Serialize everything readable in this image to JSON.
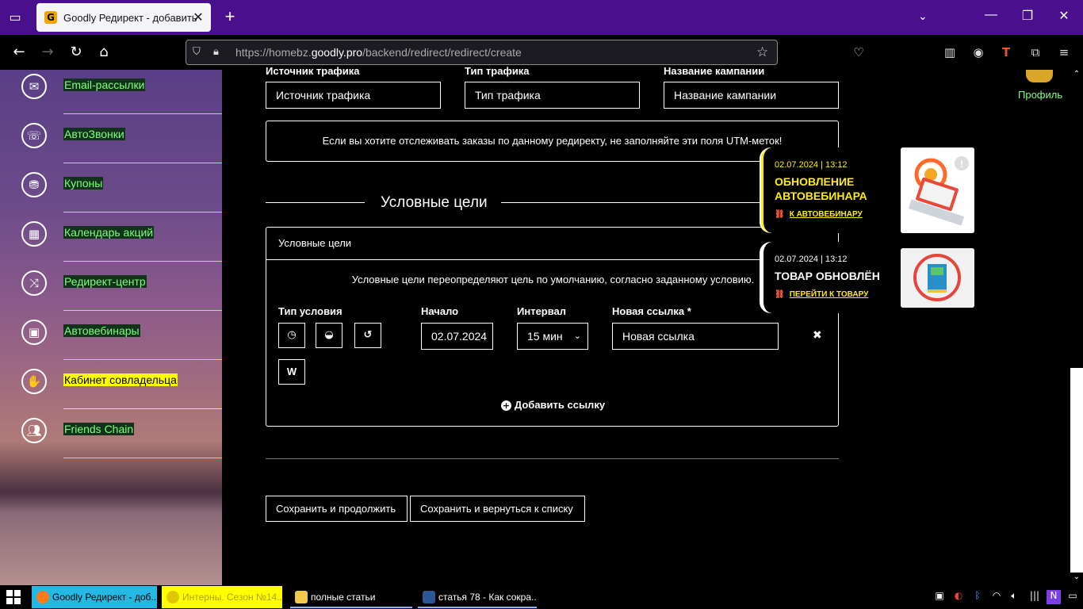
{
  "browser": {
    "tab_title": "Goodly Редирект - добавить",
    "url_prefix": "https://homebz.",
    "url_domain": "goodly.pro",
    "url_path": "/backend/redirect/redirect/create"
  },
  "sidebar": {
    "items": [
      {
        "label": "Email-рассылки",
        "icon": "envelope-icon"
      },
      {
        "label": "АвтоЗвонки",
        "icon": "phone-icon"
      },
      {
        "label": "Купоны",
        "icon": "coupon-icon"
      },
      {
        "label": "Календарь акций",
        "icon": "calendar-icon"
      },
      {
        "label": "Редирект-центр",
        "icon": "shuffle-icon"
      },
      {
        "label": "Автовебинары",
        "icon": "webinar-icon"
      },
      {
        "label": "Кабинет совладельца",
        "icon": "handshake-icon"
      },
      {
        "label": "Friends Chain",
        "icon": "friends-icon"
      }
    ]
  },
  "form": {
    "utm_source_label": "Источник трафика",
    "utm_source_placeholder": "Источник трафика",
    "utm_medium_label": "Тип трафика",
    "utm_medium_placeholder": "Тип трафика",
    "utm_campaign_label": "Название кампании",
    "utm_campaign_placeholder": "Название кампании",
    "utm_note": "Если вы хотите отслеживать заказы по данному редиректу, не заполняйте эти поля UTM-меток!",
    "section_title": "Условные цели",
    "panel_title": "Условные цели",
    "panel_description": "Условные цели переопределяют цель по умолчанию, согласно заданному условию.",
    "condition_type_label": "Тип условия",
    "start_label": "Начало",
    "start_value": "02.07.2024",
    "interval_label": "Интервал",
    "interval_value": "15 мин",
    "new_link_label": "Новая ссылка *",
    "new_link_placeholder": "Новая ссылка",
    "weekday_button": "W",
    "add_link": "Добавить ссылку",
    "save_continue": "Сохранить и продолжить",
    "save_return": "Сохранить и вернуться к списку"
  },
  "profile_label": "Профиль",
  "notifications": [
    {
      "date": "02.07.2024 | 13:12",
      "title_line1": "ОБНОВЛЕНИЕ",
      "title_line2": "АВТОВЕБИНАРА",
      "link": "К АВТОВЕБИНАРУ",
      "accent": "#ffee00"
    },
    {
      "date": "02.07.2024 | 13:12",
      "title_line1": "ТОВАР ОБНОВЛЁН",
      "title_line2": "",
      "link": "ПЕРЕЙТИ К ТОВАРУ",
      "accent": "#ffffff"
    }
  ],
  "taskbar": {
    "items": [
      {
        "label": "Goodly Редирект - доб..."
      },
      {
        "label": "Интерны. Сезон №14..."
      },
      {
        "label": "полные статьи"
      },
      {
        "label": "статья 78 - Как сокра..."
      }
    ]
  },
  "colors": {
    "tabbar": "#4a0f8c",
    "sidebar_label": "#7dff7d",
    "highlight_yellow": "#ffff00",
    "accent_yellow": "#ffee00"
  }
}
